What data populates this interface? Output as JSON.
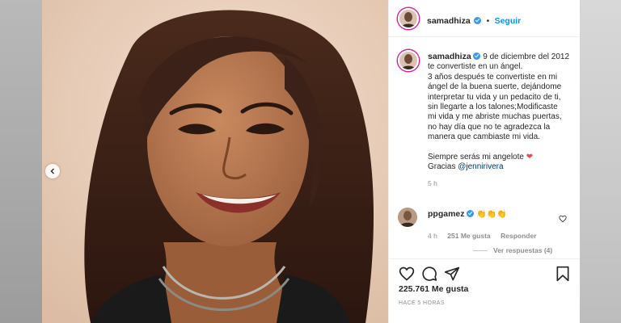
{
  "post": {
    "author": "samadhiza",
    "follow_label": "Seguir",
    "dot": "•",
    "caption_lines": [
      "9 de diciembre del 2012",
      "te convertiste en un ángel.",
      "3 años después te convertiste en mi",
      "ángel de la buena suerte, dejándome",
      "interpretar tu vida y un pedacito de ti,",
      "sin llegarte a los talones;Modificaste",
      "mi vida y me abriste muchas puertas,",
      "no hay día que no te agradezca la",
      "manera que cambiaste mi vida."
    ],
    "closing_line": "Siempre serás mi angelote",
    "heart": "❤",
    "thanks_prefix": "Gracias ",
    "mention": "@jennirivera",
    "caption_age": "5 h",
    "likes": "225.761 Me gusta",
    "posted": "HACE 5 HORAS"
  },
  "comment": {
    "author": "ppgamez",
    "emojis": "👏👏👏",
    "age": "4 h",
    "likes": "251 Me gusta",
    "reply_label": "Responder",
    "view_replies": "Ver respuestas (4)"
  },
  "icons": {
    "prev": "chevron-left-icon",
    "like": "heart-outline-icon",
    "comment": "comment-bubble-icon",
    "share": "paper-plane-icon",
    "save": "bookmark-icon",
    "comment_like": "small-heart-icon",
    "verified": "verified-badge-icon"
  },
  "colors": {
    "accent": "#0095f6",
    "verified": "#3897f0",
    "heart": "#ed4956",
    "muted": "#8e8e8e"
  }
}
